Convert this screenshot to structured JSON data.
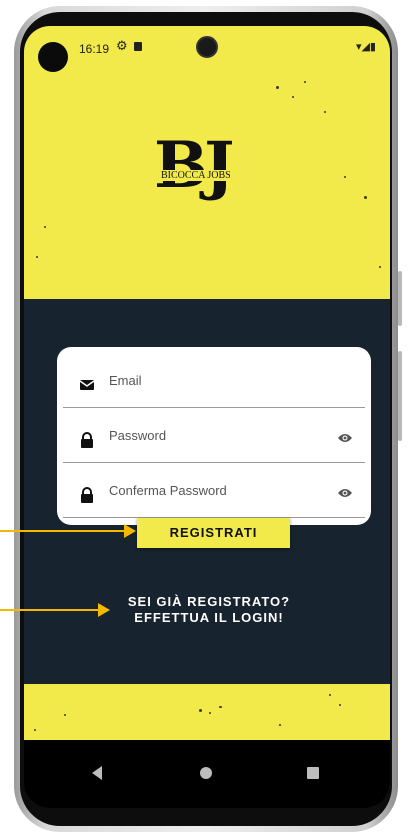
{
  "status_bar": {
    "time": "16:19",
    "icons": [
      "gear-icon",
      "sd-card-icon"
    ],
    "system_icons_text": "▾◢▮"
  },
  "logo": {
    "big_text": "BJ",
    "small_text": "BICOCCA JOBS"
  },
  "form": {
    "email_placeholder": "Email",
    "password_placeholder": "Password",
    "confirm_password_placeholder": "Conferma Password"
  },
  "register_button_label": "REGISTRATI",
  "login_link": {
    "line1": "SEI GIÀ REGISTRATO?",
    "line2": "EFFETTUA IL LOGIN!"
  },
  "colors": {
    "accent_yellow": "#f2ea4a",
    "background_dark": "#17232e",
    "arrow_orange": "#f5b800"
  }
}
